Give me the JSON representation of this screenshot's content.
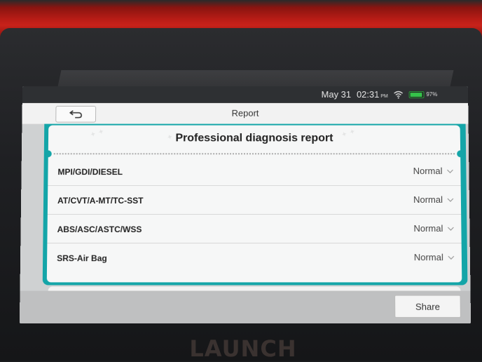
{
  "status_bar": {
    "date": "May 31",
    "time": "02:31",
    "ampm": "PM",
    "battery_percent": "97%",
    "battery_level": 0.97
  },
  "header": {
    "title": "Report",
    "back_icon": "back-arrow-icon"
  },
  "report": {
    "heading": "Professional diagnosis report",
    "rows": [
      {
        "label": "MPI/GDI/DIESEL",
        "status": "Normal"
      },
      {
        "label": "AT/CVT/A-MT/TC-SST",
        "status": "Normal"
      },
      {
        "label": "ABS/ASC/ASTC/WSS",
        "status": "Normal"
      },
      {
        "label": "SRS-Air Bag",
        "status": "Normal"
      }
    ]
  },
  "footer": {
    "share_label": "Share"
  },
  "device": {
    "brand": "LAUNCH"
  },
  "colors": {
    "accent": "#14a5a8",
    "battery": "#35c24a"
  }
}
